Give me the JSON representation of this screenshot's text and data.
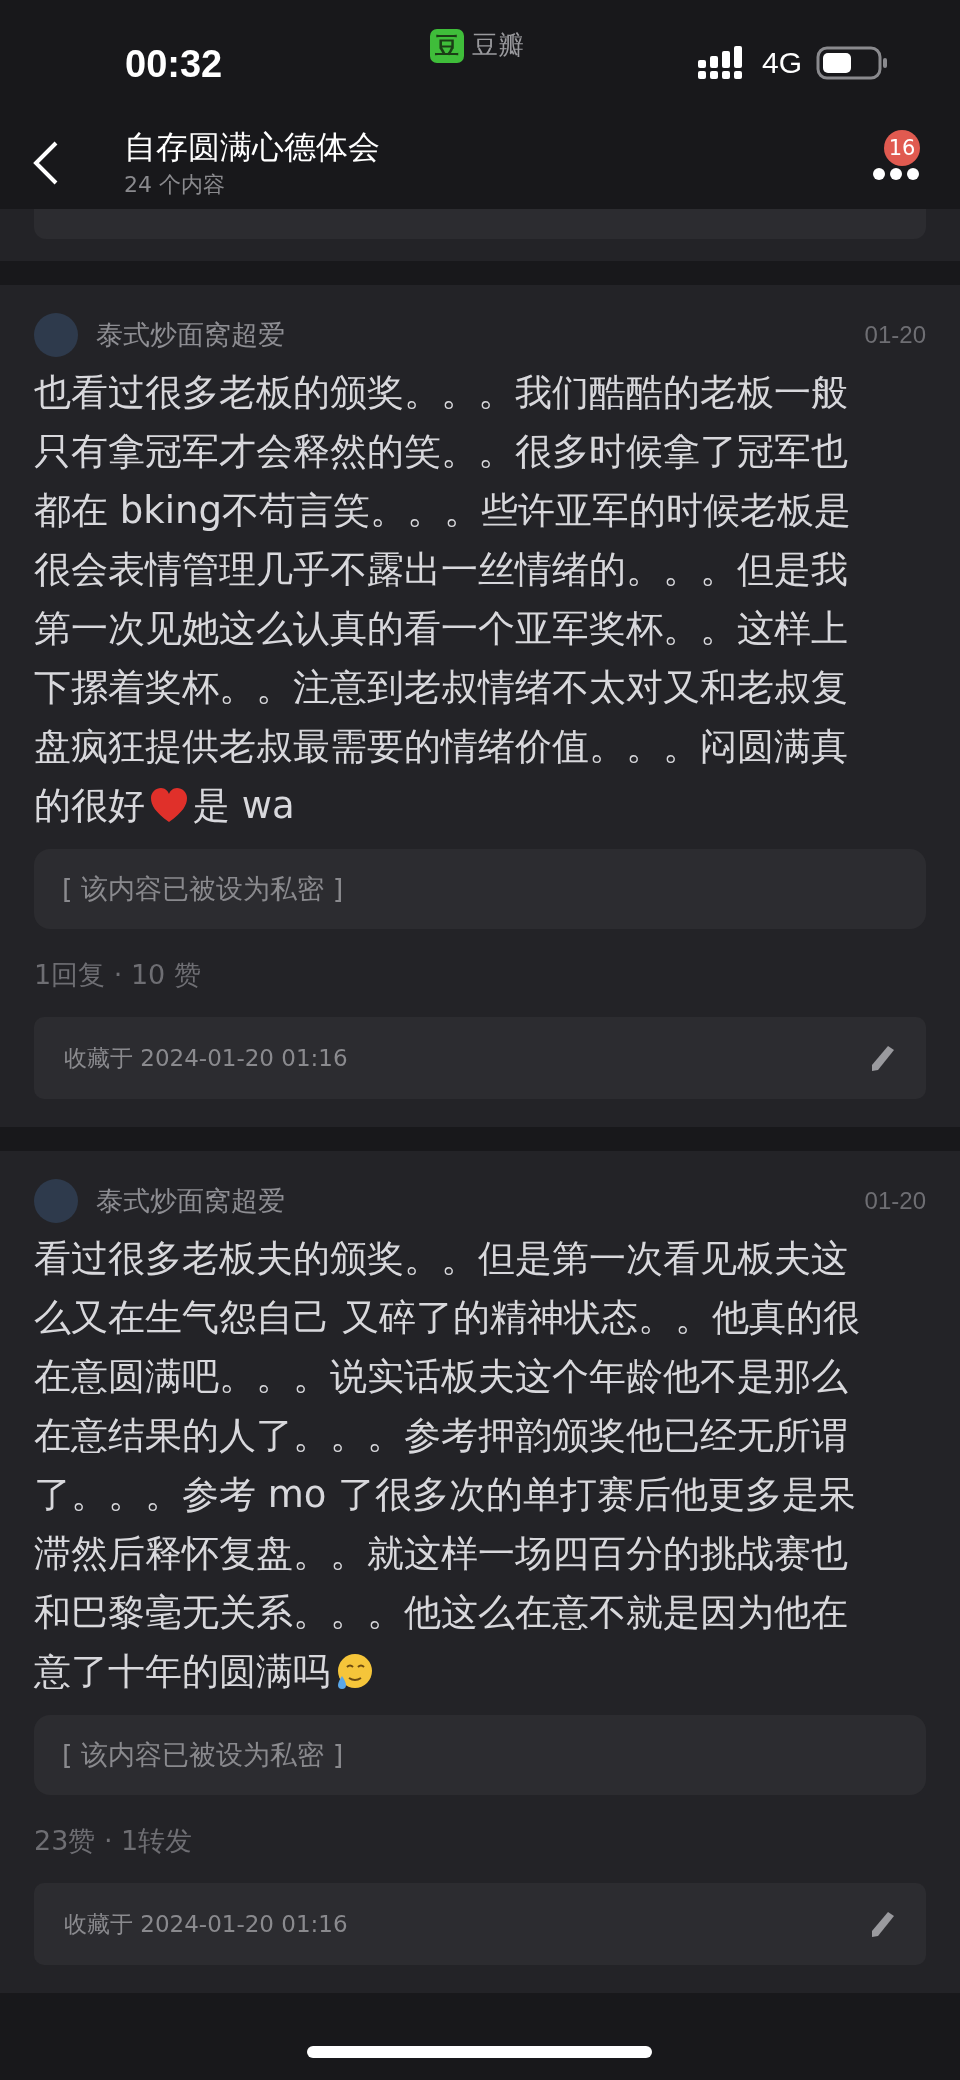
{
  "status_bar": {
    "time": "00:32",
    "app_icon_char": "豆",
    "app_name": "豆瓣",
    "network": "4G"
  },
  "nav": {
    "title": "自存圆满心德体会",
    "subtitle": "24 个内容",
    "badge": "16"
  },
  "posts": [
    {
      "author": "泰式炒面窝超爱",
      "date": "01-20",
      "body": [
        [
          {
            "kind": "text",
            "text": "也看过很多老板的颁奖。。。我们酷酷的老板一般"
          }
        ],
        [
          {
            "kind": "text",
            "text": "只有拿冠军才会释然的笑。。很多时候拿了冠军也"
          }
        ],
        [
          {
            "kind": "text",
            "text": "都在 bking不苟言笑。。。些许亚军的时候老板是"
          }
        ],
        [
          {
            "kind": "text",
            "text": "很会表情管理几乎不露出一丝情绪的。。。但是我"
          }
        ],
        [
          {
            "kind": "text",
            "text": "第一次见她这么认真的看一个亚军奖杯。。这样上"
          }
        ],
        [
          {
            "kind": "text",
            "text": "下摞着奖杯。。注意到老叔情绪不太对又和老叔复"
          }
        ],
        [
          {
            "kind": "text",
            "text": "盘疯狂提供老叔最需要的情绪价值。。。闷圆满真"
          }
        ],
        [
          {
            "kind": "text",
            "text": "的很好"
          },
          {
            "kind": "heart"
          },
          {
            "kind": "text",
            "text": "是 wa"
          }
        ]
      ],
      "private_note": "[ 该内容已被设为私密 ]",
      "stats": "1回复 · 10 赞",
      "collected": "收藏于 2024-01-20 01:16"
    },
    {
      "author": "泰式炒面窝超爱",
      "date": "01-20",
      "body": [
        [
          {
            "kind": "text",
            "text": "看过很多老板夫的颁奖。。但是第一次看见板夫这"
          }
        ],
        [
          {
            "kind": "text",
            "text": "么又在生气怨自己 又碎了的精神状态。。他真的很"
          }
        ],
        [
          {
            "kind": "text",
            "text": "在意圆满吧。。。说实话板夫这个年龄他不是那么"
          }
        ],
        [
          {
            "kind": "text",
            "text": "在意结果的人了。。。参考押韵颁奖他已经无所谓"
          }
        ],
        [
          {
            "kind": "text",
            "text": "了。。。参考 mo 了很多次的单打赛后他更多是呆"
          }
        ],
        [
          {
            "kind": "text",
            "text": "滞然后释怀复盘。。就这样一场四百分的挑战赛也"
          }
        ],
        [
          {
            "kind": "text",
            "text": "和巴黎毫无关系。。。他这么在意不就是因为他在"
          }
        ],
        [
          {
            "kind": "text",
            "text": "意了十年的圆满吗"
          },
          {
            "kind": "tear"
          }
        ]
      ],
      "private_note": "[ 该内容已被设为私密 ]",
      "stats": "23赞 · 1转发",
      "collected": "收藏于 2024-01-20 01:16"
    }
  ]
}
